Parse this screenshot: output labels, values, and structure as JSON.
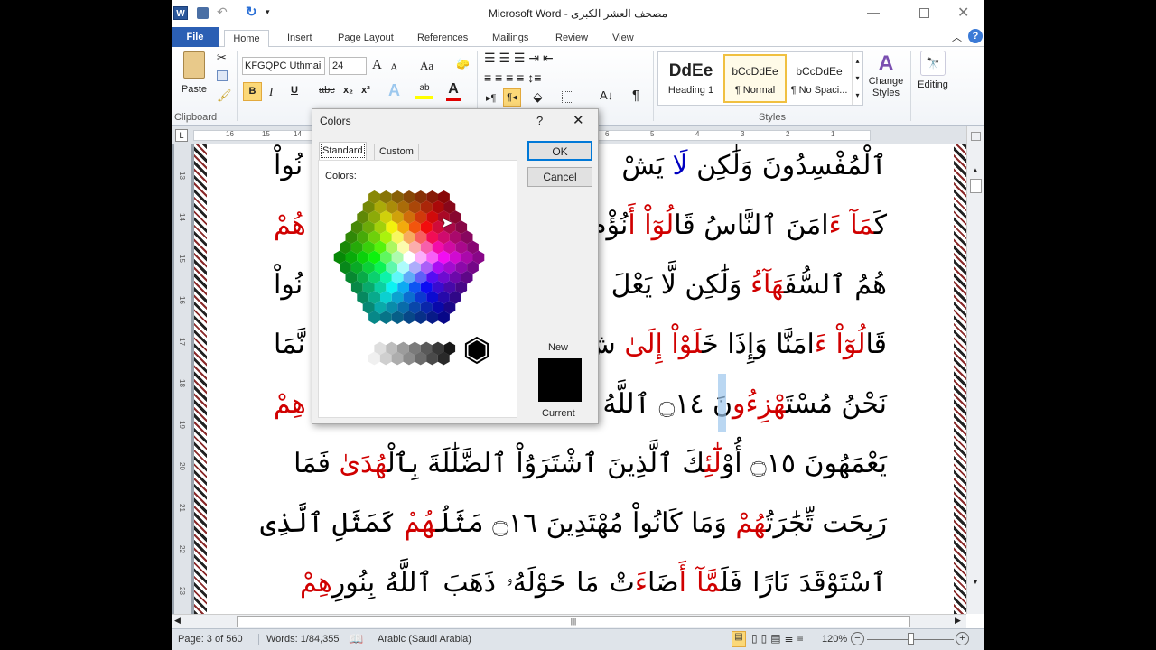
{
  "window": {
    "title": "مصحف العشر الكبرى  -  Microsoft Word"
  },
  "tabs": [
    {
      "label": "File"
    },
    {
      "label": "Home"
    },
    {
      "label": "Insert"
    },
    {
      "label": "Page Layout"
    },
    {
      "label": "References"
    },
    {
      "label": "Mailings"
    },
    {
      "label": "Review"
    },
    {
      "label": "View"
    }
  ],
  "ribbon": {
    "clipboard": {
      "paste": "Paste",
      "group": "Clipboard"
    },
    "font": {
      "name": "KFGQPC Uthmai",
      "size": "24",
      "bold": "B",
      "italic": "I",
      "underline": "U",
      "strike": "abc",
      "sub": "x₂",
      "sup": "x²",
      "grow": "A",
      "shrink": "A",
      "case": "Aa"
    },
    "paragraph": {
      "pilcrow": "¶"
    },
    "styles": {
      "group": "Styles",
      "items": [
        {
          "preview": "DdEe",
          "name": "Heading 1"
        },
        {
          "preview": "bCcDdEe",
          "name": "¶ Normal"
        },
        {
          "preview": "bCcDdEe",
          "name": "¶ No Spaci..."
        }
      ],
      "change": "Change Styles"
    },
    "editing": {
      "label": "Editing"
    }
  },
  "ruler": {
    "marks": [
      "16",
      "15",
      "14",
      "8",
      "7",
      "6",
      "5",
      "4",
      "3",
      "2",
      "1"
    ]
  },
  "vruler": {
    "marks": [
      "13",
      "14",
      "15",
      "16",
      "17",
      "18",
      "19",
      "20",
      "21",
      "22",
      "23"
    ]
  },
  "colors": {
    "red": "#d00000",
    "blue": "#0000c0",
    "accent": "#2b579a"
  },
  "document": {
    "lines": [
      {
        "right": [
          {
            "t": "ٱلْمُفْسِدُونَ وَلَٰكِن "
          },
          {
            "t": "لَا",
            "c": "blue"
          },
          {
            "t": " يَشْ"
          }
        ],
        "left": [
          {
            "t": "نُواْ"
          }
        ]
      },
      {
        "right": [
          {
            "t": "كَ"
          },
          {
            "t": "مَآ",
            "c": "red"
          },
          {
            "t": " "
          },
          {
            "t": "ءَ",
            "c": "red"
          },
          {
            "t": "امَنَ ٱلنَّاسُ قَا"
          },
          {
            "t": "لُوٓاْ",
            "c": "red"
          },
          {
            "t": " "
          },
          {
            "t": "أَ",
            "c": "red"
          },
          {
            "t": "نُؤْمِ"
          }
        ],
        "left": [
          {
            "t": "هُمْ",
            "c": "red"
          }
        ]
      },
      {
        "right": [
          {
            "t": "هُمُ ٱلسُّفَ"
          },
          {
            "t": "هَآءُ",
            "c": "red"
          },
          {
            "t": " وَلَٰكِن لَّا يَعْلَ"
          }
        ],
        "left": [
          {
            "t": "نُواْ"
          }
        ]
      },
      {
        "right": [
          {
            "t": "قَا"
          },
          {
            "t": "لُوٓاْ",
            "c": "red"
          },
          {
            "t": " "
          },
          {
            "t": "ءَ",
            "c": "red"
          },
          {
            "t": "امَنَّا وَإِذَا خَ"
          },
          {
            "t": "لَوْاْ",
            "c": "red"
          },
          {
            "t": " "
          },
          {
            "t": "إِلَىٰ",
            "c": "red"
          },
          {
            "t": " شَ"
          }
        ],
        "left": [
          {
            "t": "نَّمَا"
          }
        ]
      },
      {
        "right": [
          {
            "t": "نَحْنُ مُسْتَ"
          },
          {
            "t": "هْزِءُو",
            "c": "red"
          },
          {
            "t": "نَ ۝١٤ ٱللَّهُ يَسْ"
          }
        ],
        "left": [
          {
            "t": "هِمْ",
            "c": "red"
          }
        ]
      },
      {
        "full": [
          {
            "t": "يَعْمَهُونَ ۝١٥ أُوْ"
          },
          {
            "t": "لَٰٓئِ",
            "c": "red"
          },
          {
            "t": "كَ ٱلَّذِينَ ٱشْتَرَوُاْ ٱلضَّلَٰلَةَ بِٱلْ"
          },
          {
            "t": "هُدَىٰ",
            "c": "red"
          },
          {
            "t": " فَمَا"
          }
        ]
      },
      {
        "full": [
          {
            "t": "رَبِحَت تِّجَٰرَتُ"
          },
          {
            "t": "هُمْ",
            "c": "red"
          },
          {
            "t": " وَمَا كَانُواْ مُهْتَدِينَ ۝١٦ مَثَلُ"
          },
          {
            "t": "هُمْ",
            "c": "red"
          },
          {
            "t": " كَمَثَلِ ٱلَّذِى"
          }
        ]
      },
      {
        "full": [
          {
            "t": "ٱسْتَوْقَدَ نَارًا فَلَ"
          },
          {
            "t": "مَّآ",
            "c": "red"
          },
          {
            "t": " "
          },
          {
            "t": "أَ",
            "c": "red"
          },
          {
            "t": "ضَا"
          },
          {
            "t": "ءَ",
            "c": "red"
          },
          {
            "t": "تْ مَا حَوْلَهُۥ ذَهَبَ ٱللَّهُ بِنُورِ"
          },
          {
            "t": "هِمْ",
            "c": "red"
          }
        ]
      }
    ]
  },
  "dialog": {
    "title": "Colors",
    "help": "?",
    "tabs": [
      {
        "label": "Standard"
      },
      {
        "label": "Custom"
      }
    ],
    "colors_label": "Colors:",
    "ok": "OK",
    "cancel": "Cancel",
    "new_label": "New",
    "current_label": "Current",
    "new_color": "#000000",
    "current_color": "#000000"
  },
  "status": {
    "page": "Page: 3 of 560",
    "words": "Words: 1/84,355",
    "language": "Arabic (Saudi Arabia)",
    "zoom": "120%",
    "zoom_percent": 120
  }
}
